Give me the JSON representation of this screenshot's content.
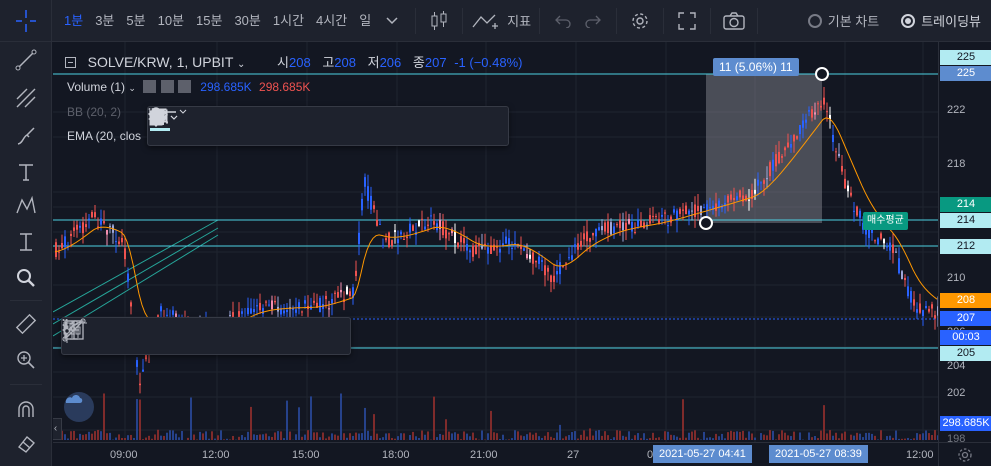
{
  "toolbar": {
    "timeframes": [
      "1분",
      "3분",
      "5분",
      "10분",
      "15분",
      "30분",
      "1시간",
      "4시간",
      "일"
    ],
    "active_timeframe": "1분",
    "indicators_label": "지표",
    "chart_modes": [
      {
        "label": "기본 차트",
        "selected": false
      },
      {
        "label": "트레이딩뷰",
        "selected": true
      }
    ]
  },
  "left_tools": [
    "crosshair-icon",
    "trendline-icon",
    "pitchfork-icon",
    "brush-icon",
    "text-icon",
    "pattern-icon",
    "measure-icon",
    "zoom-icon",
    "ruler-icon",
    "zoom-in-icon",
    "magnet-icon",
    "eraser-icon"
  ],
  "legend": {
    "symbol": "SOLVE/KRW, 1, UPBIT",
    "open_label": "시",
    "open": "208",
    "high_label": "고",
    "high": "208",
    "low_label": "저",
    "low": "206",
    "close_label": "종",
    "close": "207",
    "change": "-1 (−0.48%)",
    "volume_label": "Volume (1)",
    "volume_values": [
      "298.685K",
      "298.685K"
    ],
    "bb_label": "BB (20, 2)",
    "ema_label": "EMA (20, clos"
  },
  "measure_label": "11 (5.06%) 11",
  "buy_avg_label": "매수평균",
  "price_axis": {
    "ticks": [
      "225",
      "222",
      "218",
      "214",
      "212",
      "210",
      "206",
      "204",
      "202",
      "198"
    ],
    "labels": [
      {
        "text": "225",
        "bg": "#b2ebf2",
        "fg": "#131722"
      },
      {
        "text": "225",
        "bg": "#5d8ccf",
        "fg": "#ffffff"
      },
      {
        "text": "214",
        "bg": "#089981",
        "fg": "#ffffff"
      },
      {
        "text": "214",
        "bg": "#b2ebf2",
        "fg": "#131722"
      },
      {
        "text": "212",
        "bg": "#b2ebf2",
        "fg": "#131722"
      },
      {
        "text": "208",
        "bg": "#ff9800",
        "fg": "#ffffff"
      },
      {
        "text": "207",
        "bg": "#2962ff",
        "fg": "#ffffff"
      },
      {
        "text": "00:03",
        "bg": "#2962ff",
        "fg": "#ffffff"
      },
      {
        "text": "205",
        "bg": "#b2ebf2",
        "fg": "#131722"
      },
      {
        "text": "298.685K",
        "bg": "#2962ff",
        "fg": "#ffffff"
      }
    ]
  },
  "time_axis": {
    "ticks": [
      "09:00",
      "12:00",
      "15:00",
      "18:00",
      "21:00",
      "27",
      "0",
      "12:00"
    ],
    "highlight_labels": [
      "2021-05-27   04:41",
      "2021-05-27   08:39"
    ]
  },
  "colors": {
    "bg": "#131722",
    "panel": "#1e222d",
    "up": "#2962ff",
    "down": "#ef5350",
    "hline": "#4dd0e1",
    "trend": "#26a69a",
    "ema": "#ff9800",
    "measure": "#5d8ccf"
  }
}
